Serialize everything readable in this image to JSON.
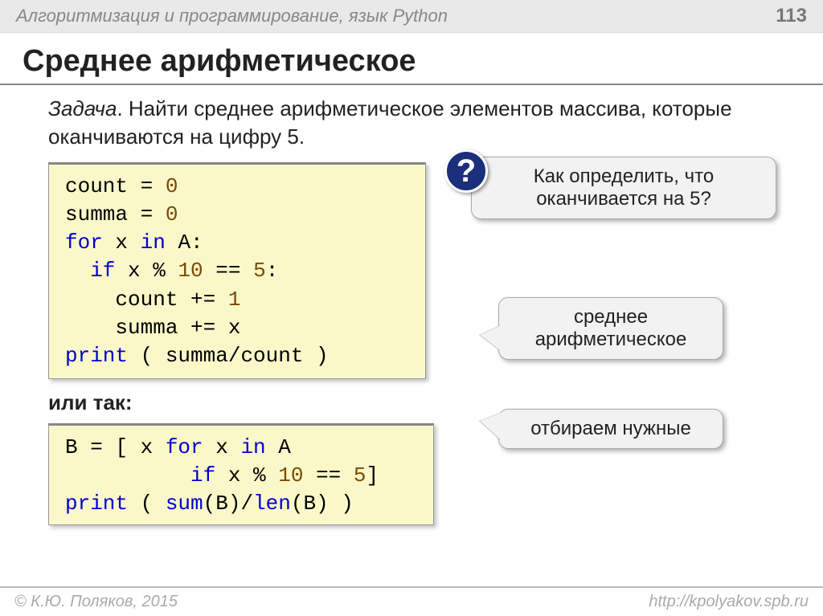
{
  "header": {
    "category": "Алгоритмизация и программирование, язык Python",
    "page": "113"
  },
  "title": "Среднее арифметическое",
  "task": {
    "label": "Задача",
    "text": ". Найти среднее арифметическое элементов массива, которые оканчиваются на цифру 5."
  },
  "code1": {
    "l1a": "count",
    "l1b": " = ",
    "l1c": "0",
    "l2a": "summa",
    "l2b": " = ",
    "l2c": "0",
    "l3a": "for",
    "l3b": " x ",
    "l3c": "in",
    "l3d": " A:",
    "l4a": "  if",
    "l4b": " x % ",
    "l4c": "10",
    "l4d": " == ",
    "l4e": "5",
    "l4f": ":",
    "l5a": "    count",
    "l5b": " += ",
    "l5c": "1",
    "l6a": "    summa",
    "l6b": " += x",
    "l7a": "print",
    "l7b": " ( summa/count )"
  },
  "or_so": "или так:",
  "code2": {
    "l1a": "B",
    "l1b": " = [ x ",
    "l1c": "for",
    "l1d": " x ",
    "l1e": "in",
    "l1f": " A",
    "l2a": "          if",
    "l2b": " x % ",
    "l2c": "10",
    "l2d": " == ",
    "l2e": "5",
    "l2f": "]",
    "l3a": "print",
    "l3b": " ( ",
    "l3c": "sum",
    "l3d": "(B)/",
    "l3e": "len",
    "l3f": "(B) )"
  },
  "callouts": {
    "q": "?",
    "c1": "Как определить, что оканчивается на 5?",
    "c2": "среднее арифметическое",
    "c3": "отбираем нужные"
  },
  "footer": {
    "author": "© К.Ю. Поляков, 2015",
    "url": "http://kpolyakov.spb.ru"
  }
}
